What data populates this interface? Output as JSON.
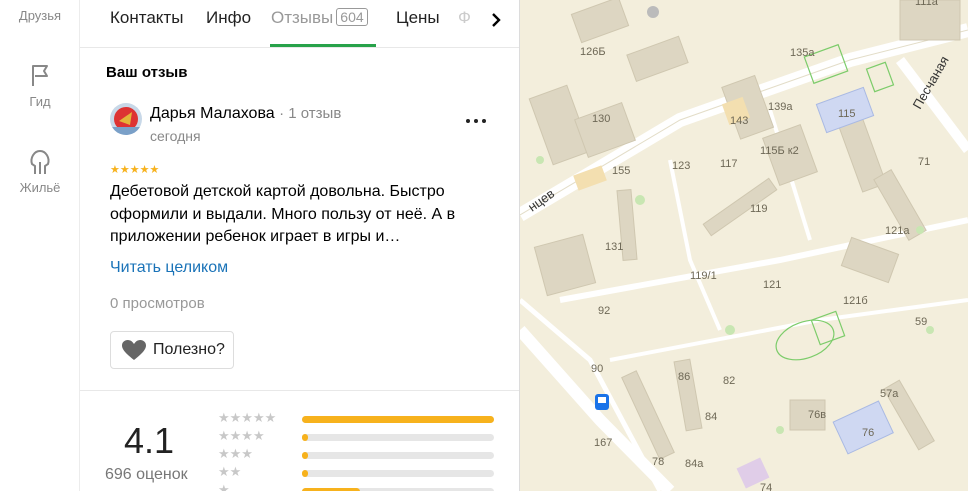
{
  "rail": [
    {
      "label": "Друзья",
      "icon": "friends-icon"
    },
    {
      "label": "Гид",
      "icon": "flag-icon"
    },
    {
      "label": "Жильё",
      "icon": "house-icon"
    }
  ],
  "tabs": [
    {
      "label": "Контакты"
    },
    {
      "label": "Инфо"
    },
    {
      "label": "Отзывы",
      "badge": "604",
      "active": true
    },
    {
      "label": "Цены"
    },
    {
      "label": "Ф"
    }
  ],
  "review_section": {
    "title": "Ваш отзыв",
    "author": "Дарья Малахова",
    "author_reviews": "1 отзыв",
    "date": "сегодня",
    "stars": 5,
    "stars_text": "★★★★★",
    "text": "Дебетовой детской картой довольна. Быстро оформили и выдали. Много пользу от неё. А в приложении ребенок играет в игры и…",
    "read_more": "Читать целиком",
    "views": "0 просмотров",
    "useful_label": "Полезно?"
  },
  "summary": {
    "rating": "4.1",
    "count_label": "696 оценок",
    "histogram": [
      {
        "stars": "★★★★★",
        "fraction": 1.0
      },
      {
        "stars": "★★★★",
        "fraction": 0.03
      },
      {
        "stars": "★★★",
        "fraction": 0.03
      },
      {
        "stars": "★★",
        "fraction": 0.03
      },
      {
        "stars": "★",
        "fraction": 0.3
      }
    ]
  },
  "map": {
    "streets": [
      "Песчаная",
      "нцев"
    ],
    "house_numbers": [
      "126Б",
      "135а",
      "111а",
      "130",
      "143",
      "139а",
      "115",
      "115Б к2",
      "71",
      "155",
      "123",
      "117",
      "119",
      "121а",
      "131",
      "119/1",
      "121",
      "121б",
      "59",
      "92",
      "90",
      "86",
      "82",
      "57а",
      "84",
      "76в",
      "76",
      "167",
      "78",
      "84а",
      "74"
    ],
    "accent_colors": {
      "building": "#d9d2bf",
      "school": "#cfd8f2",
      "sport": "#bfe3b4",
      "road": "#ffffff"
    }
  }
}
